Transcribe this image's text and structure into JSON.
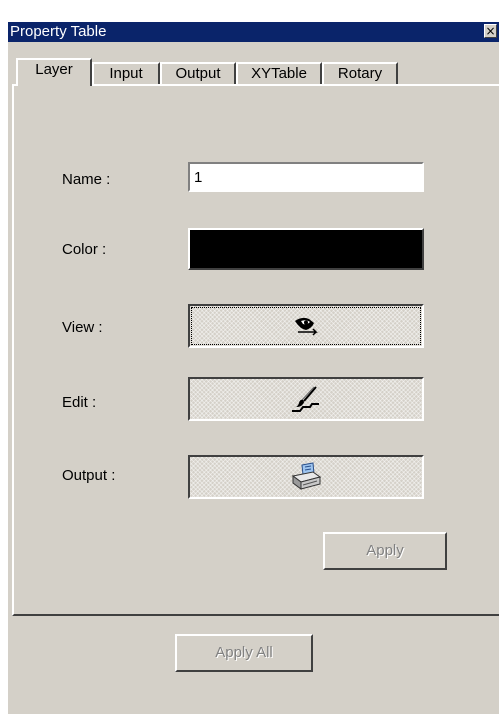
{
  "window": {
    "title": "Property Table",
    "close_glyph": "×"
  },
  "tabs": [
    {
      "label": "Layer",
      "active": true
    },
    {
      "label": "Input",
      "active": false
    },
    {
      "label": "Output",
      "active": false
    },
    {
      "label": "XYTable",
      "active": false
    },
    {
      "label": "Rotary",
      "active": false
    }
  ],
  "layer": {
    "name_label": "Name :",
    "name_value": "1",
    "color_label": "Color :",
    "color_value": "#000000",
    "view_label": "View :",
    "view_icon": "eye-icon",
    "edit_label": "Edit :",
    "edit_icon": "brush-icon",
    "output_label": "Output :",
    "output_icon": "printer-icon",
    "apply_label": "Apply"
  },
  "footer": {
    "apply_all_label": "Apply All"
  },
  "colors": {
    "title_bar": "#0a246a",
    "face": "#d4d0c8",
    "disabled_text": "#808080"
  }
}
